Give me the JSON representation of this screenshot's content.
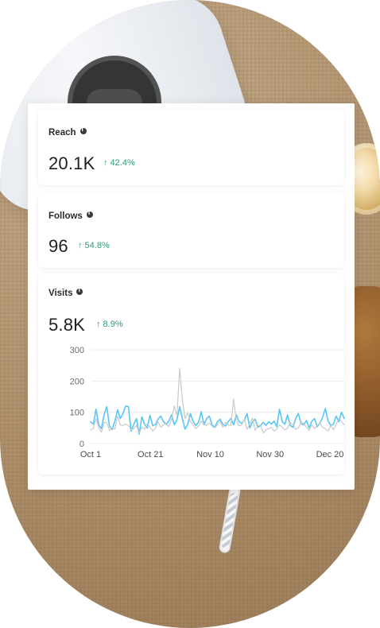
{
  "metrics": {
    "reach": {
      "label": "Reach",
      "value": "20.1K",
      "delta": "↑ 42.4%"
    },
    "follows": {
      "label": "Follows",
      "value": "96",
      "delta": "↑ 54.8%"
    },
    "visits": {
      "label": "Visits",
      "value": "5.8K",
      "delta": "↑ 8.9%"
    }
  },
  "chart_data": {
    "type": "line",
    "title": "",
    "xlabel": "",
    "ylabel": "",
    "ylim": [
      0,
      300
    ],
    "yticks": [
      0,
      100,
      200,
      300
    ],
    "xticks": [
      "Oct 1",
      "Oct 21",
      "Nov 10",
      "Nov 30",
      "Dec 20"
    ],
    "grid": true,
    "series": [
      {
        "values": [
          70,
          62,
          110,
          60,
          48,
          92,
          118,
          55,
          45,
          72,
          108,
          80,
          96,
          120,
          118,
          40,
          62,
          80,
          30,
          86,
          62,
          50,
          90,
          58,
          60,
          78,
          88,
          70,
          62,
          72,
          92,
          60,
          76,
          118,
          80,
          46,
          62,
          96,
          70,
          58,
          68,
          102,
          60,
          80,
          88,
          60,
          52,
          70,
          78,
          62,
          56,
          70,
          80,
          60,
          92,
          70,
          64,
          76,
          96,
          50,
          70,
          78,
          52,
          58,
          68,
          58,
          70,
          62,
          72,
          54,
          110,
          70,
          62,
          92,
          58,
          52,
          80,
          96,
          64,
          60,
          74,
          50,
          72,
          80,
          54,
          66,
          84,
          112,
          72,
          58,
          62,
          88,
          70,
          100,
          80
        ]
      },
      {
        "values": [
          44,
          48,
          80,
          52,
          36,
          68,
          66,
          42,
          50,
          46,
          88,
          60,
          58,
          62,
          58,
          44,
          48,
          58,
          34,
          52,
          46,
          64,
          52,
          40,
          48,
          70,
          52,
          60,
          64,
          54,
          78,
          120,
          90,
          240,
          140,
          80,
          98,
          70,
          60,
          48,
          56,
          72,
          62,
          58,
          66,
          56,
          50,
          60,
          72,
          52,
          68,
          60,
          58,
          142,
          72,
          56,
          60,
          78,
          46,
          64,
          82,
          42,
          58,
          58,
          34,
          44,
          48,
          52,
          40,
          46,
          60,
          52,
          44,
          50,
          68,
          60,
          46,
          50,
          70,
          64,
          52,
          42,
          60,
          48,
          58,
          66,
          52,
          48,
          40,
          58,
          44,
          62,
          80,
          70,
          60
        ]
      }
    ]
  }
}
